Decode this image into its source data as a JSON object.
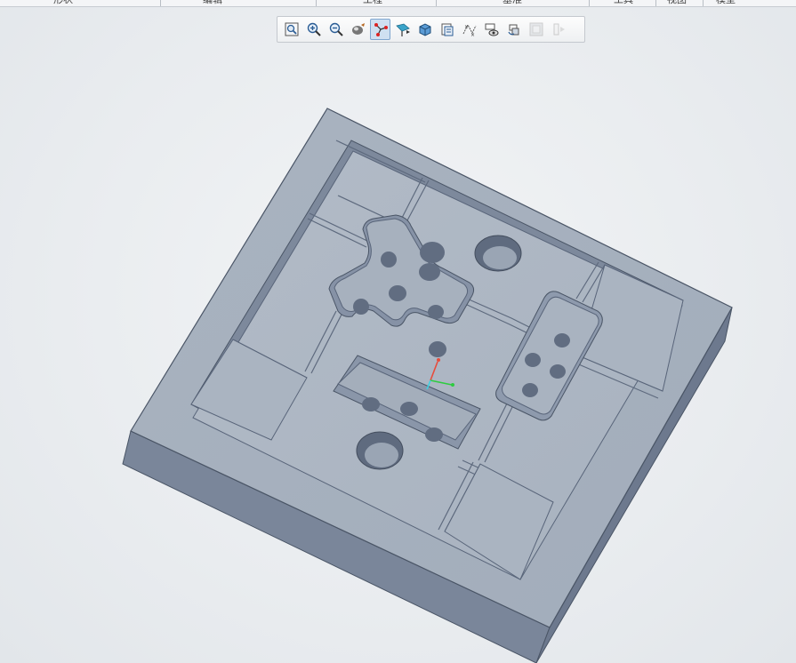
{
  "ribbon": {
    "labels": [
      "形状",
      "编辑",
      "工程",
      "基准",
      "工具",
      "视图",
      "模型"
    ]
  },
  "toolbar": {
    "buttons": [
      {
        "icon": "zoom-fit-icon",
        "state": "normal"
      },
      {
        "icon": "zoom-in-icon",
        "state": "normal"
      },
      {
        "icon": "zoom-out-icon",
        "state": "normal"
      },
      {
        "icon": "repaint-icon",
        "state": "normal"
      },
      {
        "icon": "spin-center-icon",
        "state": "active"
      },
      {
        "icon": "datum-display-icon",
        "state": "normal"
      },
      {
        "icon": "display-style-icon",
        "state": "normal"
      },
      {
        "icon": "saved-views-icon",
        "state": "normal"
      },
      {
        "icon": "datum-points-icon",
        "state": "normal"
      },
      {
        "icon": "view-manager-icon",
        "state": "normal"
      },
      {
        "icon": "annotation-display-icon",
        "state": "normal"
      },
      {
        "icon": "perspective-icon",
        "state": "disabled"
      },
      {
        "icon": "model-tree-icon",
        "state": "disabled"
      }
    ]
  },
  "model": {
    "part_color": "#9aa6b6",
    "axis_colors": {
      "x": "#2ecc40",
      "y": "#e74c3c",
      "z": "#3fd0e0"
    }
  }
}
